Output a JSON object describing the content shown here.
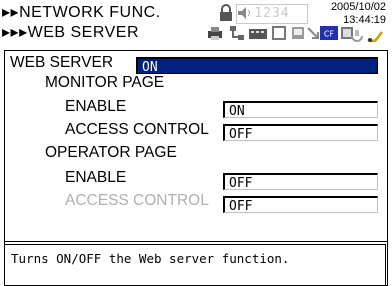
{
  "header": {
    "menu_path_line1": "▸▸NETWORK FUNC.",
    "menu_path_line2": "▸▸▸WEB SERVER",
    "date": "2005/10/02",
    "time": "13:44:19",
    "lcd_value": "1234",
    "icons": [
      "printer-icon",
      "lock-icon",
      "speaker-icon",
      "network-icon",
      "keyboard-icon",
      "trend-icon",
      "cf-card-icon",
      "card-icon",
      "settings-icon",
      "usb-icon"
    ]
  },
  "settings": {
    "web_server": {
      "label": "WEB SERVER",
      "value": "ON"
    },
    "monitor_page": {
      "title": "MONITOR PAGE",
      "enable": {
        "label": "ENABLE",
        "value": "ON"
      },
      "access_control": {
        "label": "ACCESS CONTROL",
        "value": "OFF"
      }
    },
    "operator_page": {
      "title": "OPERATOR PAGE",
      "enable": {
        "label": "ENABLE",
        "value": "OFF"
      },
      "access_control": {
        "label": "ACCESS CONTROL",
        "value": "OFF"
      }
    }
  },
  "help_text": "Turns ON/OFF the Web server function.",
  "colors": {
    "selection": "#002080",
    "dim_text": "#b0b0b0"
  }
}
